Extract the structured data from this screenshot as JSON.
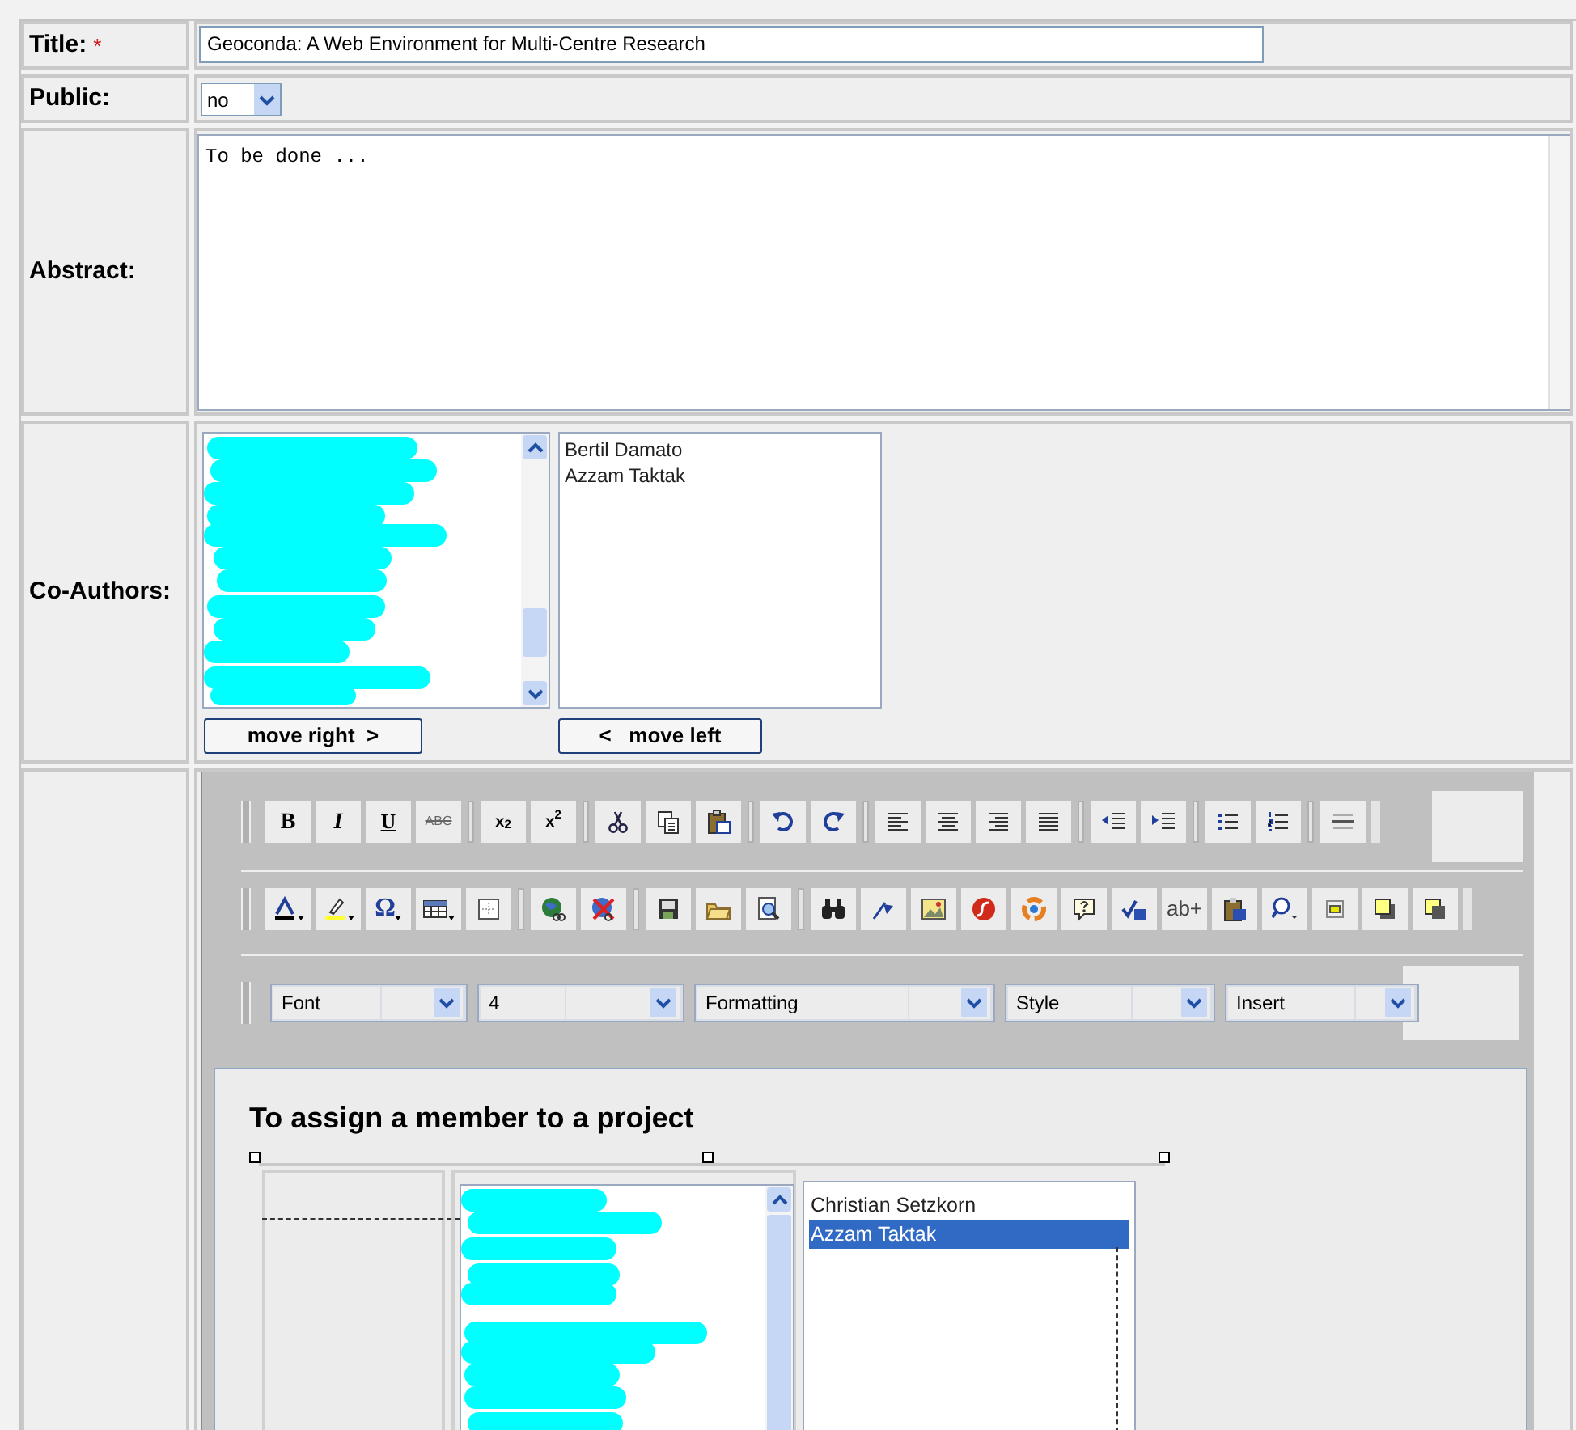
{
  "form": {
    "title": {
      "label": "Title:",
      "required_mark": "*",
      "value": "Geoconda: A Web Environment for Multi-Centre Research"
    },
    "public": {
      "label": "Public:",
      "value": "no"
    },
    "abstract": {
      "label": "Abstract:",
      "value": "To be done ..."
    },
    "co_authors": {
      "label": "Co-Authors:",
      "chosen": [
        "Bertil Damato",
        "Azzam Taktak"
      ],
      "move_right": "move right  >",
      "move_left": "<   move left"
    },
    "editor": {
      "text_buttons": [
        "B",
        "I",
        "U",
        "ABC",
        "x$_{2}$",
        "x$^{2}$",
        "Ω",
        "ab+"
      ],
      "dropdowns": [
        {
          "value": "Font"
        },
        {
          "value": "4"
        },
        {
          "value": "Formatting"
        },
        {
          "value": "Style"
        },
        {
          "value": "Insert"
        }
      ],
      "content": {
        "heading": "To assign a member to a project",
        "assigned": [
          {
            "name": "Christian Setzkorn",
            "selected": false
          },
          {
            "name": "Azzam Taktak",
            "selected": true
          }
        ]
      }
    }
  }
}
